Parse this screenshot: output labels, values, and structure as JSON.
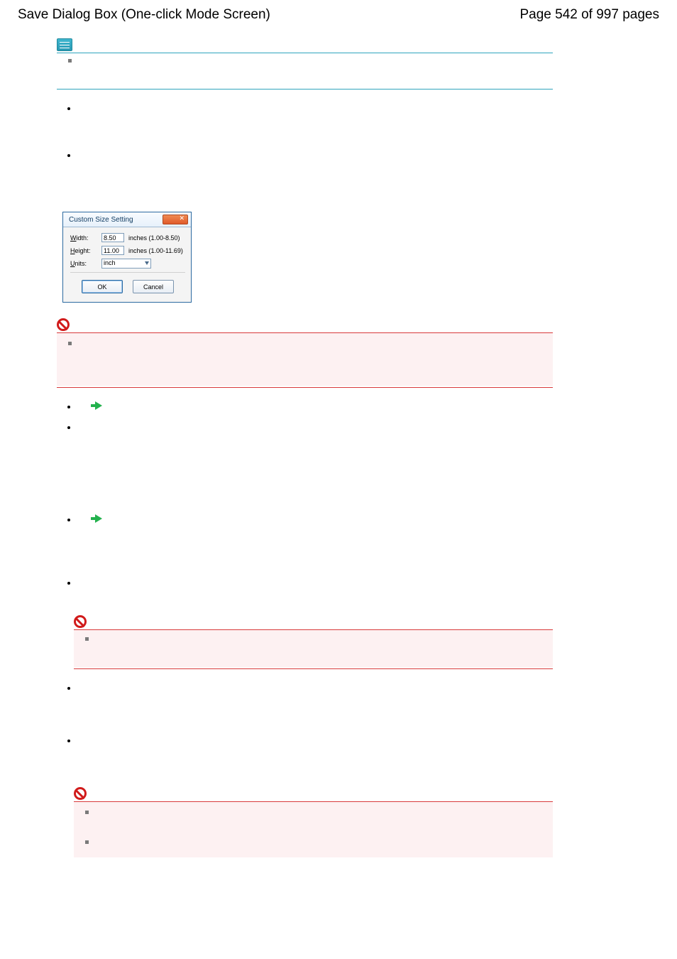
{
  "header": {
    "title": "Save Dialog Box (One-click Mode Screen)",
    "pager": "Page 542 of 997 pages"
  },
  "dialog": {
    "title": "Custom Size Setting",
    "width_label_pre": "W",
    "width_label_rest": "idth:",
    "width_value": "8.50",
    "width_hint": "inches (1.00-8.50)",
    "height_label_pre": "H",
    "height_label_rest": "eight:",
    "height_value": "11.00",
    "height_hint": "inches (1.00-11.69)",
    "units_label_pre": "U",
    "units_label_rest": "nits:",
    "units_value": "inch",
    "ok": "OK",
    "cancel": "Cancel"
  }
}
